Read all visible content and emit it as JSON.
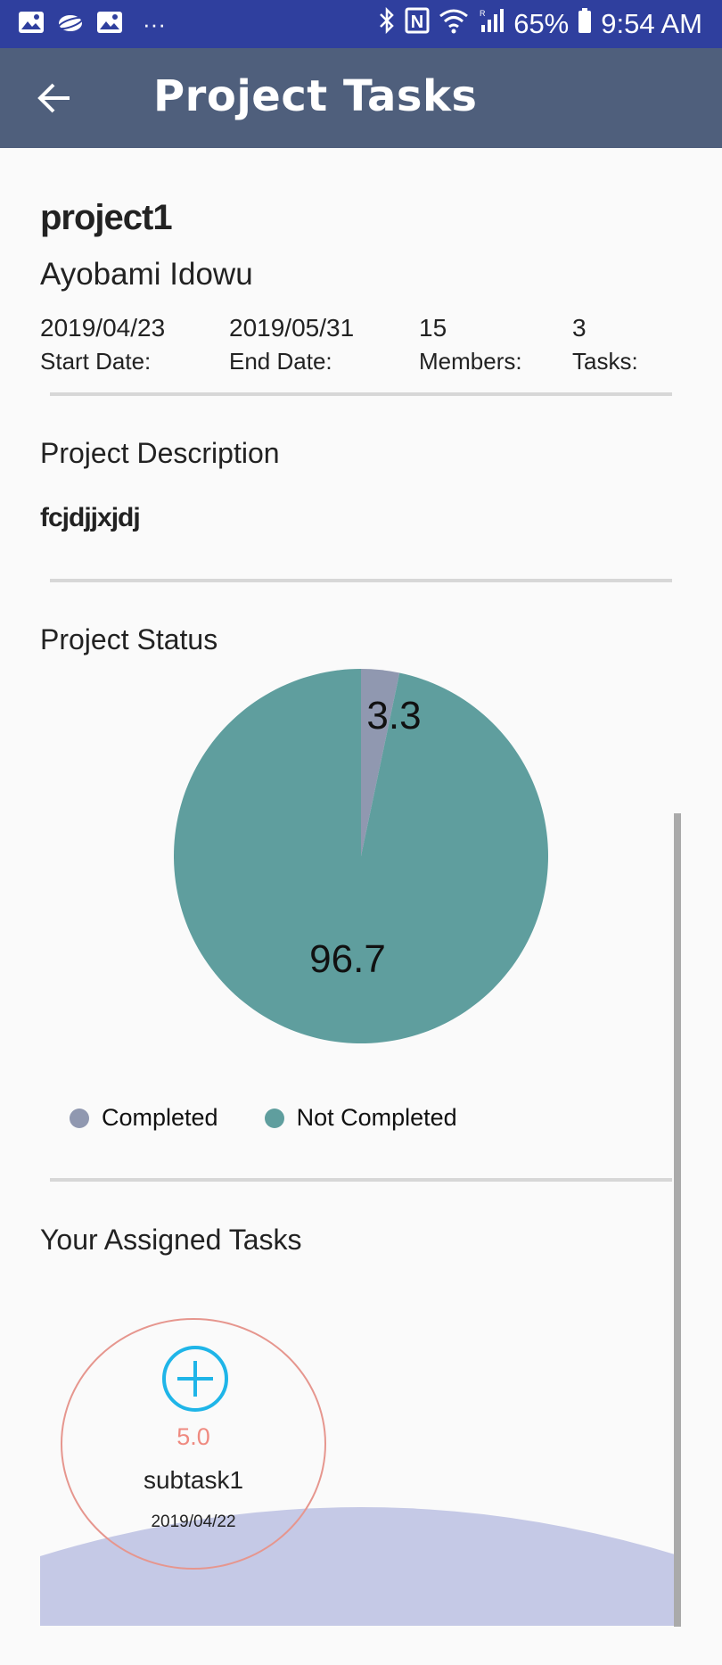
{
  "status_bar": {
    "battery": "65%",
    "time": "9:54 AM",
    "dots": "···",
    "left_icons": [
      "image-icon",
      "samsung-cloud-icon",
      "image-icon"
    ],
    "right_icons": [
      "bluetooth-icon",
      "nfc-icon",
      "wifi-icon",
      "signal-icon",
      "battery-icon"
    ]
  },
  "app_bar": {
    "title": "Project Tasks",
    "back_icon": "back-arrow-icon"
  },
  "project": {
    "name": "project1",
    "owner": "Ayobami Idowu",
    "stats": [
      {
        "value": "2019/04/23",
        "label": "Start Date:"
      },
      {
        "value": "2019/05/31",
        "label": "End Date:"
      },
      {
        "value": "15",
        "label": "Members:"
      },
      {
        "value": "3",
        "label": "Tasks:"
      }
    ]
  },
  "description": {
    "title": "Project Description",
    "text": "fcjdjjxjdj"
  },
  "status": {
    "title": "Project Status"
  },
  "chart_data": {
    "type": "pie",
    "title": "",
    "slices": [
      {
        "label": "Completed",
        "value": 3.3,
        "color": "#9098b0"
      },
      {
        "label": "Not Completed",
        "value": 96.7,
        "color": "#5f9e9e"
      }
    ],
    "legend": [
      "Completed",
      "Not Completed"
    ],
    "legend_position": "bottom",
    "data_labels": [
      "3.3",
      "96.7"
    ]
  },
  "tasks": {
    "title": "Your Assigned Tasks",
    "items": [
      {
        "score": "5.0",
        "name": "subtask1",
        "date": "2019/04/22"
      }
    ]
  },
  "colors": {
    "status_bar": "#2f3f9e",
    "app_bar": "#4f5f7c",
    "add_icon": "#1fb5e8",
    "task_border": "#e6968e",
    "task_score": "#ef8a80",
    "wave": "#c5c9e6"
  }
}
